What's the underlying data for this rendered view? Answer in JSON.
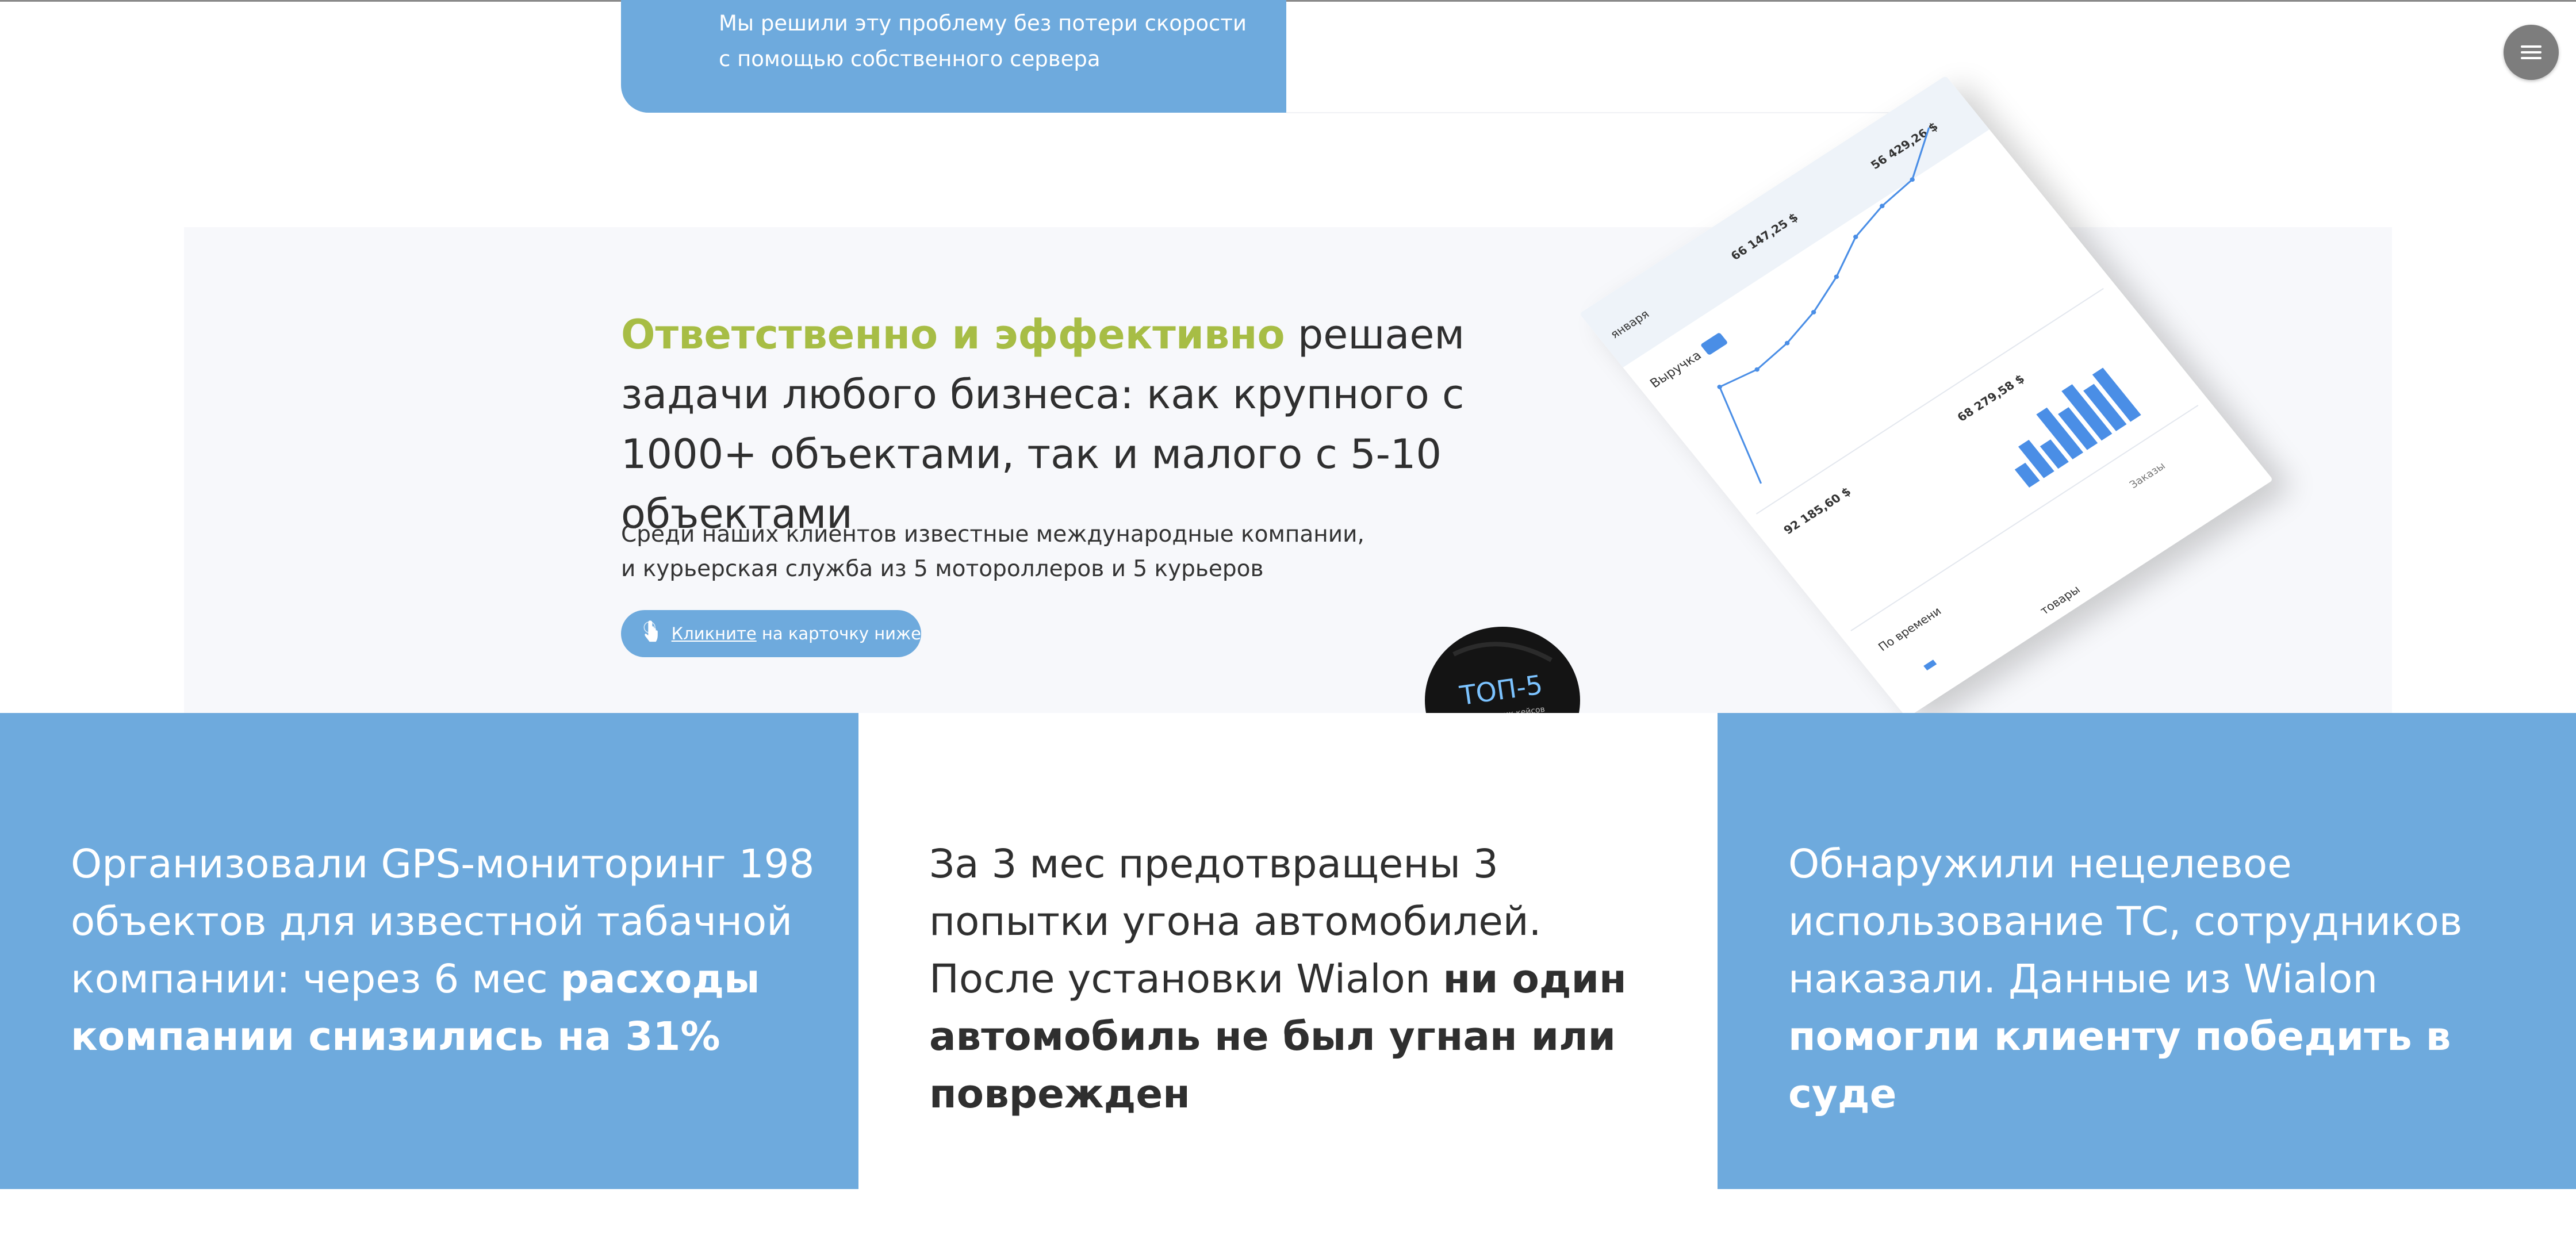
{
  "top_card": {
    "line1": "Мы решили эту проблему без потери скорости",
    "line2": "с помощью собственного сервера"
  },
  "menu": {
    "icon": "hamburger-menu-icon"
  },
  "intro": {
    "headline_accent": "Ответственно и эффективно",
    "headline_rest": " решаем задачи любого бизнеса: как крупного с 1000+ объектами, так и малого с 5-10 объектами",
    "sub_line1": "Среди наших клиентов известные международные компании,",
    "sub_line2": "и курьерская служба из 5 мотороллеров и 5 курьеров",
    "hint_link": "Кликните",
    "hint_rest": " на карточку ниже"
  },
  "dashboard": {
    "label_jan": "января",
    "val1": "66 147,25 $",
    "val2": "56 429,26 $",
    "val3": "92 185,60 $",
    "val4": "68 279,58 $",
    "revenue": "Выручка",
    "by_time": "По времени",
    "orders": "Заказы",
    "goods": "товары"
  },
  "sticker": {
    "title": "ТОП-5",
    "subtitle": "партнерских кейсов"
  },
  "cards": [
    {
      "text": "Организовали GPS-мониторинг 198 объектов для известной табачной компании: через 6 мес ",
      "bold": "расходы компании снизились на 31%"
    },
    {
      "text": "За 3 мес предотвращены 3 попытки угона автомобилей. После установки Wialon ",
      "bold": "ни один автомобиль не был угнан или поврежден"
    },
    {
      "text": "Обнаружили нецелевое использование ТС, сотрудников наказали. Данные из Wialon ",
      "bold": "помогли клиенту победить в суде"
    }
  ],
  "colors": {
    "blue": "#6eaadd",
    "accent_green": "#a7bd45",
    "band_gray": "#f7f8fb"
  }
}
